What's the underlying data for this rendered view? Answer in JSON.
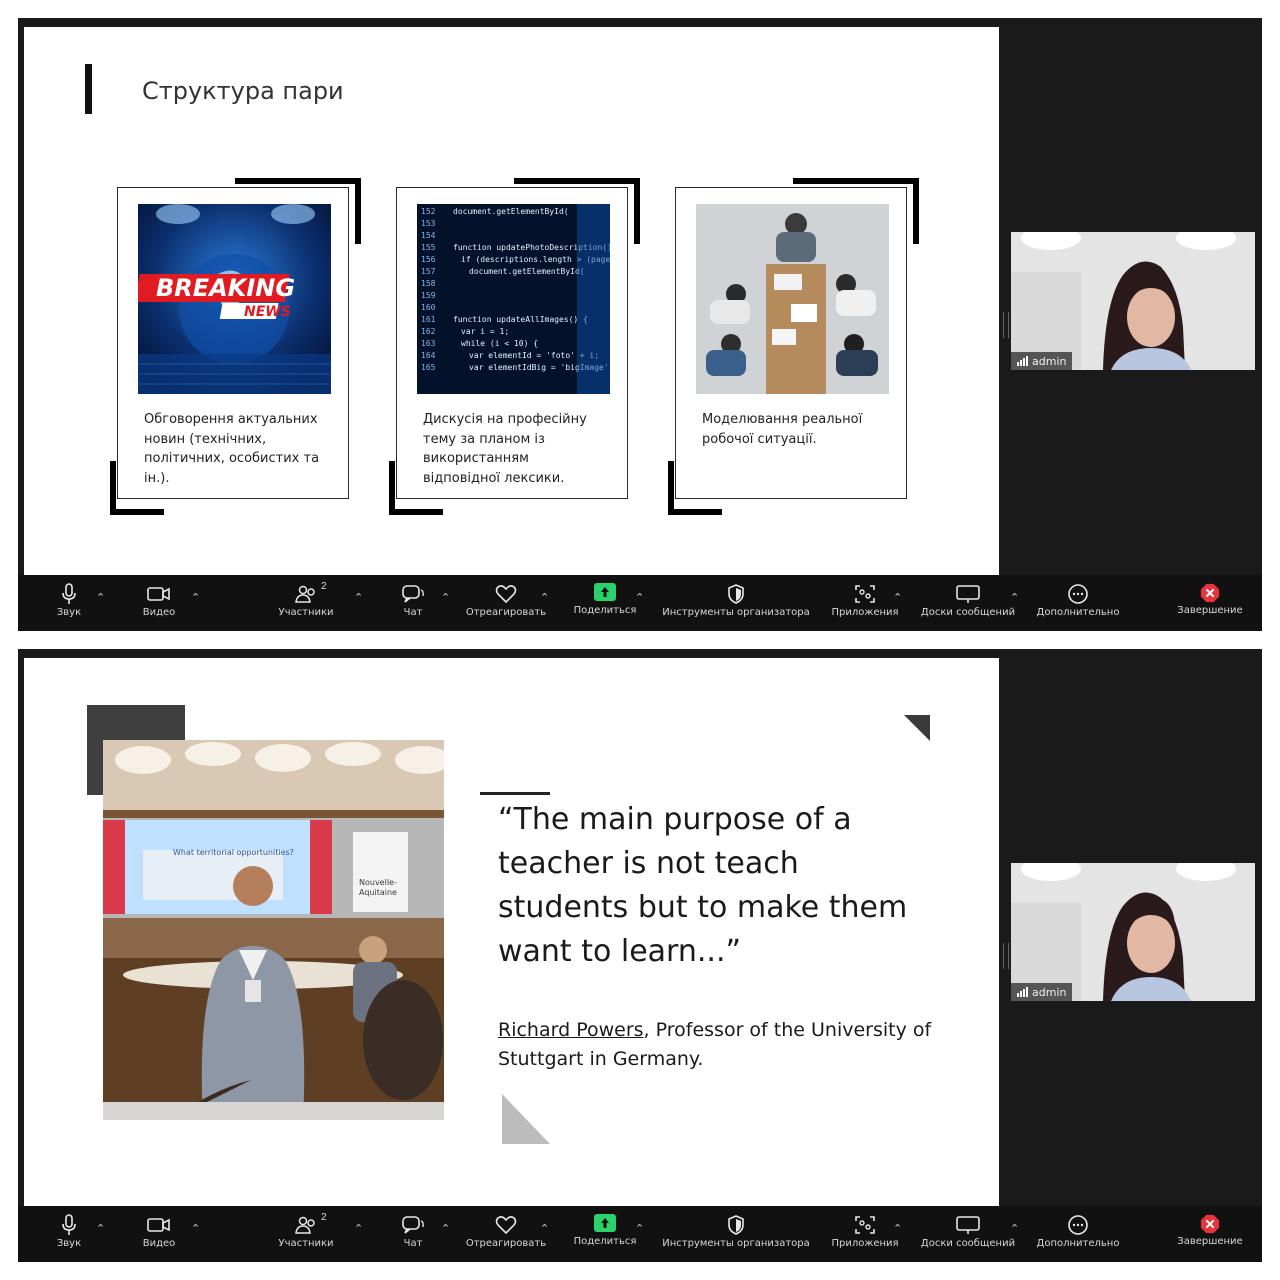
{
  "toolbar": {
    "sound": "Звук",
    "video": "Видео",
    "participants": "Участники",
    "participants_count": "2",
    "chat": "Чат",
    "react": "Отреагировать",
    "share": "Поделиться",
    "host_tools": "Инструменты организатора",
    "apps": "Приложения",
    "whiteboards": "Доски сообщений",
    "more": "Дополнительно",
    "end": "Завершение",
    "share_color": "#2bd26b",
    "end_color": "#e8323c"
  },
  "participant": {
    "name": "admin"
  },
  "slide1": {
    "title": "Структура пари",
    "cards": [
      {
        "image": "breaking-news",
        "image_text_1": "BREAKING",
        "image_text_2": "NEWS",
        "text": "Обговорення актуальних новин (технічних, політичних, особистих та ін.)."
      },
      {
        "image": "code-screen",
        "text": "Дискусія на професійну тему за планом із використанням відповідної лексики."
      },
      {
        "image": "team-meeting",
        "text": "Моделювання реальної робочої ситуації."
      }
    ]
  },
  "slide2": {
    "quote": "“The main purpose of a teacher is not teach students but to make them want to learn...”",
    "author": "Richard Powers",
    "affiliation": ", Professor of the University of Stuttgart in Germany.",
    "photo": "speaker-at-conference",
    "photo_screen_text": "What territorial opportunities?",
    "photo_banner_1": "Nouvelle-",
    "photo_banner_2": "Aquitaine"
  }
}
